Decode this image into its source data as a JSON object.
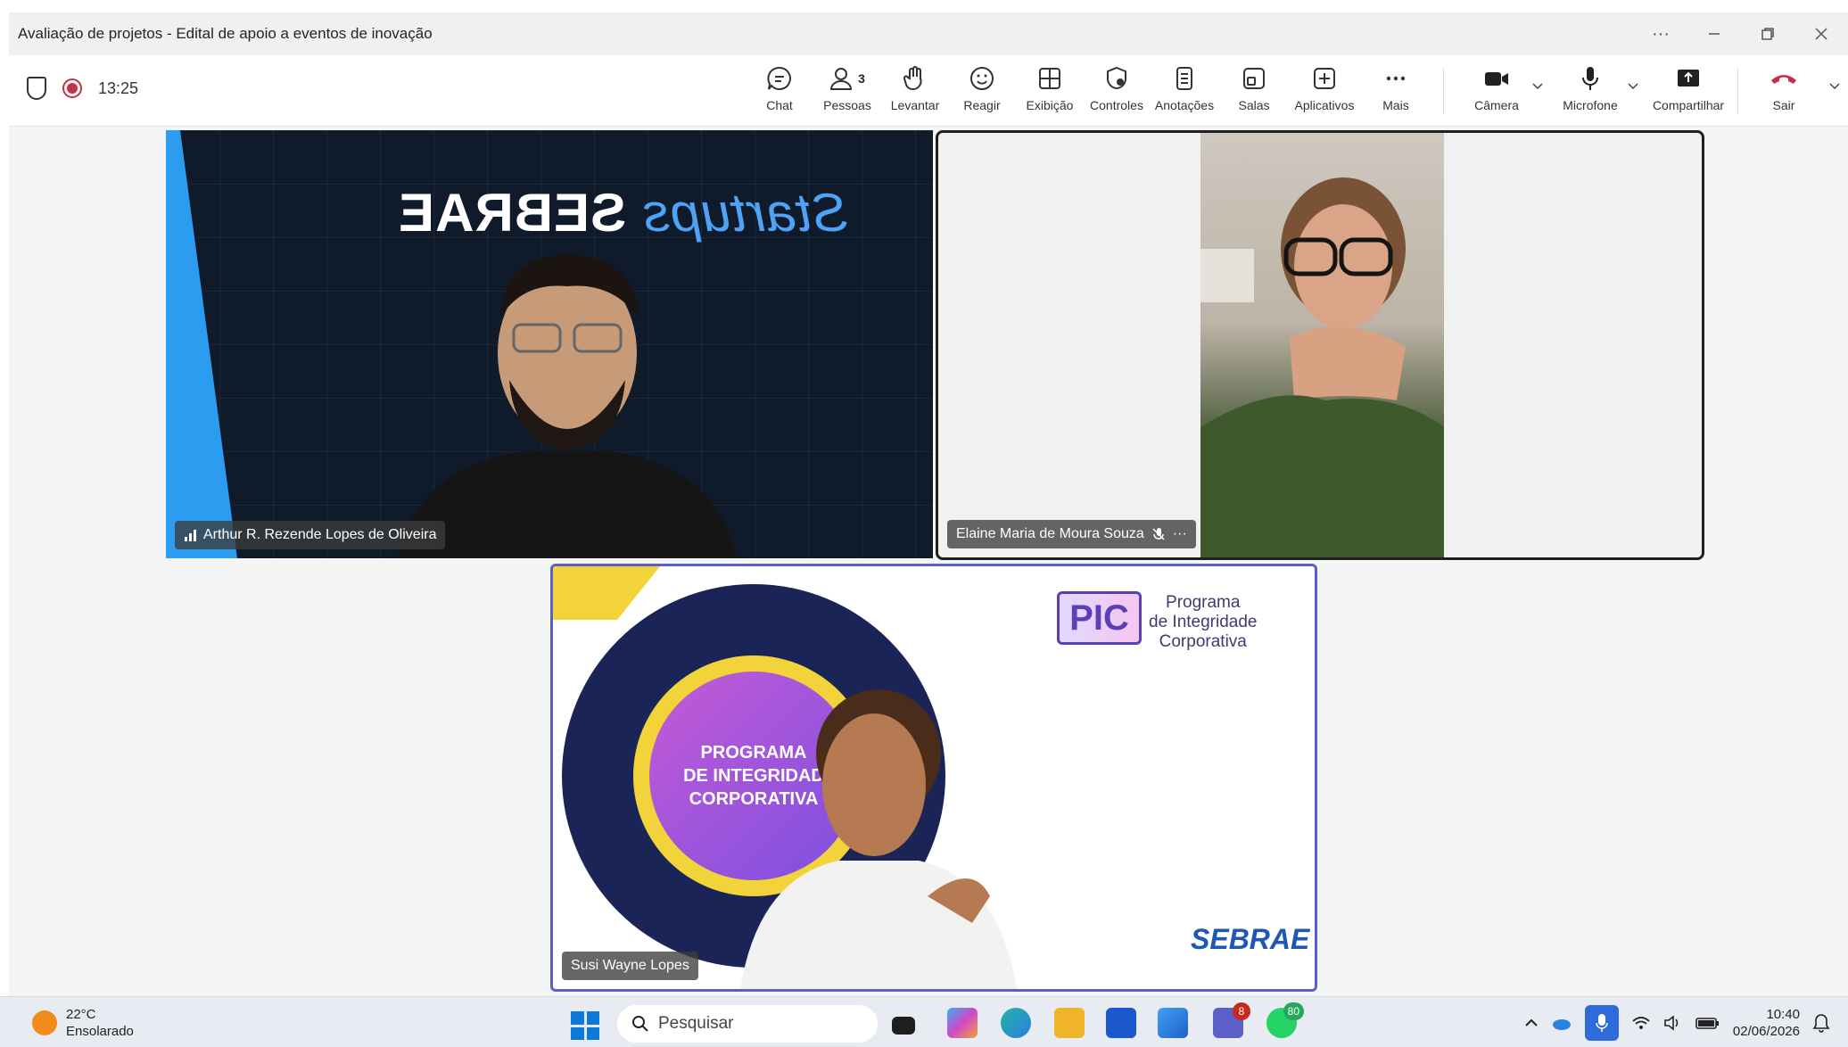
{
  "window": {
    "title": "Avaliação de projetos - Edital de apoio a eventos de inovação",
    "controls": [
      "more-icon",
      "minimize-icon",
      "restore-icon",
      "close-icon"
    ]
  },
  "meeting": {
    "timer": "13:25",
    "people_count": "3"
  },
  "toolbar": {
    "chat": "Chat",
    "people": "Pessoas",
    "raise": "Levantar",
    "react": "Reagir",
    "view": "Exibição",
    "controls": "Controles",
    "notes": "Anotações",
    "rooms": "Salas",
    "apps": "Aplicativos",
    "more": "Mais",
    "camera": "Câmera",
    "microphone": "Microfone",
    "share": "Compartilhar",
    "leave": "Sair"
  },
  "participants": {
    "p1": {
      "name": "Arthur R. Rezende Lopes de Oliveira",
      "background_text": "SEBRAE",
      "background_text_accent": "Startups"
    },
    "p2": {
      "name": "Elaine Maria de Moura Souza",
      "more": "···"
    },
    "p3": {
      "name": "Susi Wayne Lopes",
      "center_line1": "PROGRAMA",
      "center_line2": "DE INTEGRIDAD",
      "center_line3": "CORPORATIVA",
      "logo": "PIC",
      "logo_text_1": "Programa",
      "logo_text_2": "de Integridade",
      "logo_text_3": "Corporativa",
      "brand": "SEBRAE"
    }
  },
  "taskbar": {
    "temperature": "22°C",
    "weather": "Ensolarado",
    "search_placeholder": "Pesquisar",
    "teams_badge": "8",
    "whatsapp_badge": "80",
    "time": "10:40",
    "date": "02/06/2026"
  },
  "colors": {
    "teams_accent": "#5b5fc7",
    "record_red": "#c4314b",
    "leave_red": "#c4314b"
  }
}
